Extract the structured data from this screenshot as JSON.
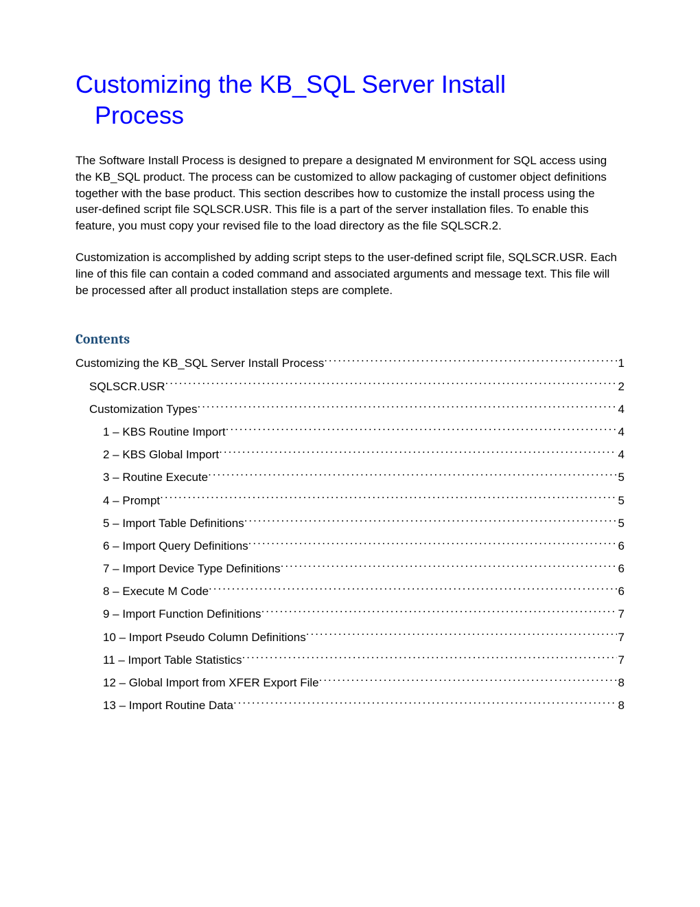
{
  "title_line1": "Customizing the KB_SQL Server Install",
  "title_line2": "Process",
  "para1": "The Software Install Process is designed to prepare a designated M environment for SQL access using the KB_SQL product.  The process can be customized to allow packaging of customer object definitions together with the base product.  This section describes how to customize the install process using the user-defined script file SQLSCR.USR.  This file is a part of the server installation files.  To enable this feature, you must copy your revised file to the load directory as the file SQLSCR.2.",
  "para2": "Customization is accomplished by adding script steps to the user-defined script file, SQLSCR.USR.  Each line of this file can contain a coded command and associated arguments and message text.  This file will be processed after all product installation steps are complete.",
  "contents_heading": "Contents",
  "toc": [
    {
      "level": 0,
      "label": "Customizing the KB_SQL Server Install Process",
      "page": "1"
    },
    {
      "level": 1,
      "label": "SQLSCR.USR",
      "page": "2"
    },
    {
      "level": 1,
      "label": "Customization Types",
      "page": "4"
    },
    {
      "level": 2,
      "label": "1 – KBS Routine Import",
      "page": "4"
    },
    {
      "level": 2,
      "label": "2 – KBS Global Import",
      "page": "4"
    },
    {
      "level": 2,
      "label": "3 – Routine Execute",
      "page": "5"
    },
    {
      "level": 2,
      "label": "4 – Prompt",
      "page": "5"
    },
    {
      "level": 2,
      "label": "5 – Import Table Definitions",
      "page": "5"
    },
    {
      "level": 2,
      "label": "6 – Import Query Definitions",
      "page": "6"
    },
    {
      "level": 2,
      "label": "7 – Import Device Type Definitions",
      "page": "6"
    },
    {
      "level": 2,
      "label": "8 – Execute M Code",
      "page": "6"
    },
    {
      "level": 2,
      "label": "9 – Import Function Definitions",
      "page": "7"
    },
    {
      "level": 2,
      "label": "10 – Import Pseudo Column Definitions",
      "page": "7"
    },
    {
      "level": 2,
      "label": "11 – Import Table Statistics",
      "page": "7"
    },
    {
      "level": 2,
      "label": "12 – Global Import from XFER Export File",
      "page": "8"
    },
    {
      "level": 2,
      "label": "13 – Import Routine Data",
      "page": "8"
    }
  ]
}
